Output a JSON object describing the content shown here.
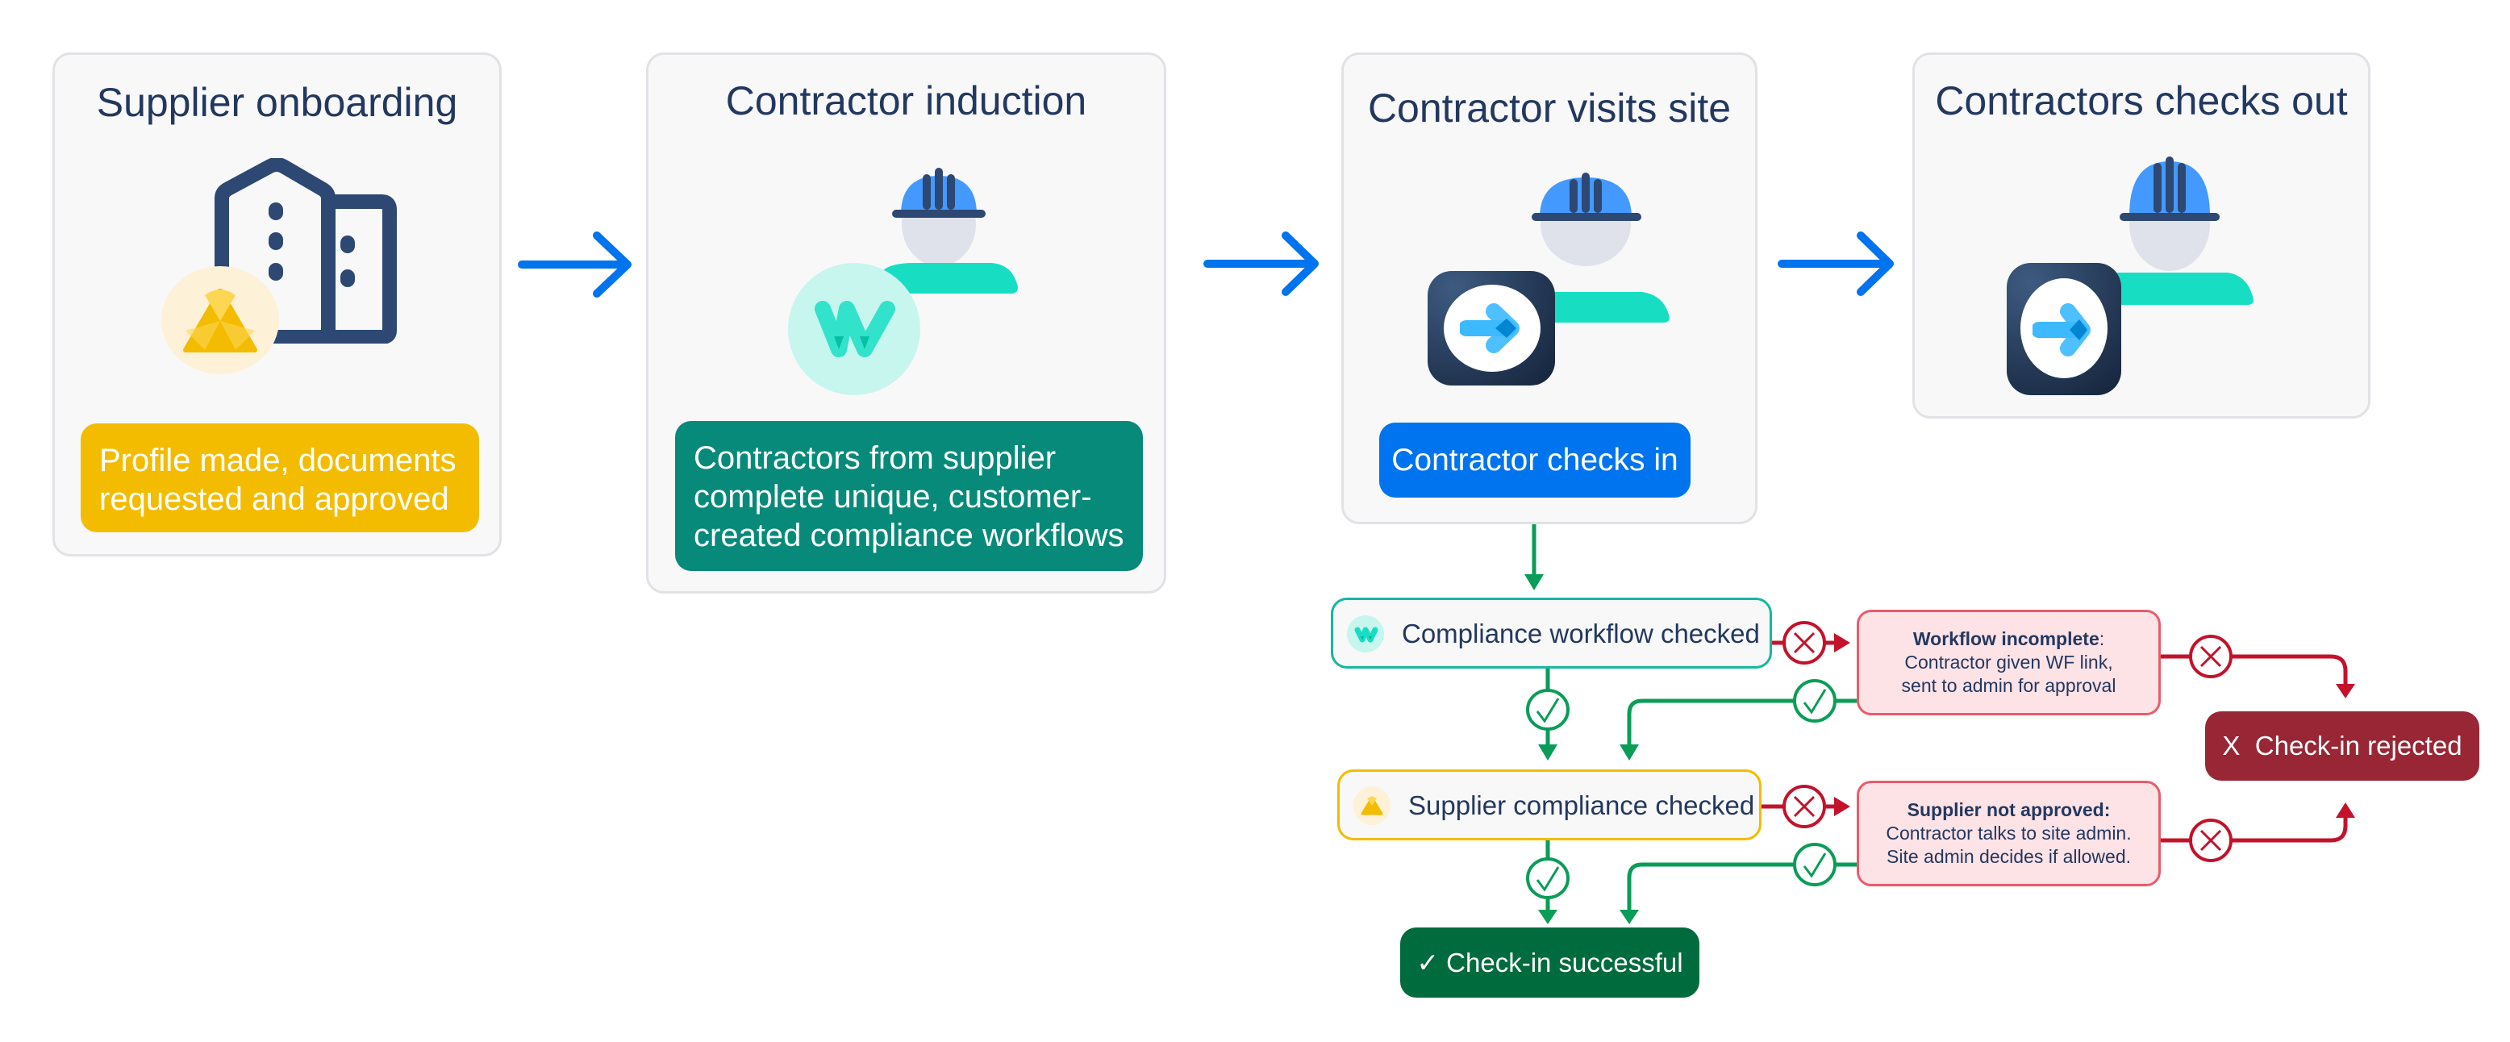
{
  "colors": {
    "card_bg": "#f8f8f9",
    "card_border": "#e1e2e6",
    "title_text": "#23385f",
    "flow_arrow_blue": "#0073ee",
    "supplier_yellow": "#f3bc00",
    "induction_teal": "#078a79",
    "checkin_blue": "#0073ee",
    "workflow_border_teal": "#14b8a0",
    "supplier_border_yellow": "#f3bc00",
    "pass_green": "#0a9d57",
    "fail_red": "#c3122a",
    "note_bg": "#fde2e6",
    "note_border": "#e85c6c",
    "success_bg": "#006b3c",
    "rejected_bg": "#982634",
    "helmet_blue": "#4499ff",
    "helmet_dark": "#2d4873",
    "face_grey": "#dfe2ea",
    "shirt_teal": "#17dec3"
  },
  "stages": [
    {
      "title": "Supplier onboarding",
      "icon": "building-icon",
      "badge_icon": "supplier-triangle-logo-icon",
      "description": [
        "Profile made, documents",
        "requested and approved"
      ]
    },
    {
      "title": "Contractor induction",
      "icon": "hard-hat-worker-icon",
      "badge_icon": "workflow-w-logo-icon",
      "description": [
        "Contractors from supplier",
        "complete unique, customer-",
        "created compliance workflows"
      ]
    },
    {
      "title": "Contractor visits site",
      "icon": "hard-hat-worker-icon",
      "badge_icon": "check-in-arrow-app-icon",
      "action": "Contractor checks in"
    },
    {
      "title": "Contractors checks out",
      "icon": "hard-hat-worker-icon",
      "badge_icon": "check-in-arrow-app-icon"
    }
  ],
  "flow": {
    "workflow_check": {
      "label": "Compliance workflow checked",
      "icon": "workflow-w-logo-icon"
    },
    "supplier_check": {
      "label": "Supplier compliance checked",
      "icon": "supplier-triangle-logo-icon"
    },
    "workflow_fail_note": {
      "title": "Workflow incomplete",
      "title_suffix": ":",
      "lines": [
        "Contractor given WF link,",
        "sent to admin for approval"
      ]
    },
    "supplier_fail_note": {
      "title": "Supplier not approved:",
      "lines": [
        "Contractor talks to site admin.",
        "Site admin decides if allowed."
      ]
    },
    "success": {
      "label": "✓ Check-in successful"
    },
    "rejected": {
      "label": "X  Check-in rejected"
    },
    "pass_icon": "check-circle-icon",
    "fail_icon": "x-circle-icon"
  }
}
